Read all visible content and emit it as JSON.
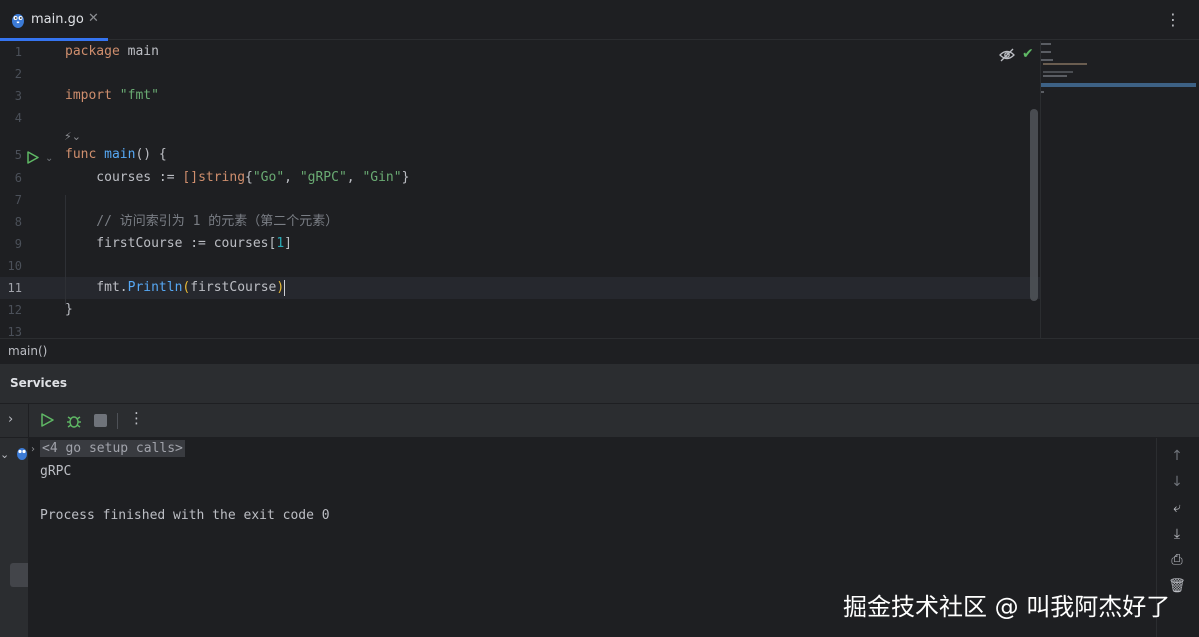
{
  "tab": {
    "title": "main.go",
    "close": "✕"
  },
  "editor": {
    "line_numbers": [
      "1",
      "2",
      "3",
      "4",
      "5",
      "6",
      "7",
      "8",
      "9",
      "10",
      "11",
      "12",
      "13"
    ],
    "code": {
      "l1_kw": "package",
      "l1_rest": " main",
      "l3_kw": "import",
      "l3_str": "\"fmt\"",
      "l5_kw": "func",
      "l5_fn": "main",
      "l5_rest": "() {",
      "l6_var": "    courses := ",
      "l6_br": "[]",
      "l6_type": "string",
      "l6_open": "{",
      "l6_s1": "\"Go\"",
      "l6_c1": ", ",
      "l6_s2": "\"gRPC\"",
      "l6_c2": ", ",
      "l6_s3": "\"Gin\"",
      "l6_close": "}",
      "l8_cmt": "    // 访问索引为 1 的元素（第二个元素）",
      "l9_var": "    firstCourse := courses",
      "l9_open": "[",
      "l9_num": "1",
      "l9_close": "]",
      "l11_pre": "    fmt.",
      "l11_fn": "Println",
      "l11_open": "(",
      "l11_arg": "firstCourse",
      "l11_close": ")",
      "l12": "}"
    },
    "current_line": "11",
    "hint_label": "⚡︎"
  },
  "breadcrumb": {
    "text": "main()"
  },
  "services": {
    "title": "Services",
    "console_lines": {
      "calls": "<4 go setup calls>",
      "output": "gRPC",
      "exit": "Process finished with the exit code 0"
    }
  },
  "watermark": "掘金技术社区 @ 叫我阿杰好了",
  "colors": {
    "accent": "#3574f0",
    "keyword": "#cf8e6d",
    "string": "#6aab73",
    "function": "#56a8f5",
    "number": "#2aacb8",
    "run_green": "#5fb865"
  }
}
